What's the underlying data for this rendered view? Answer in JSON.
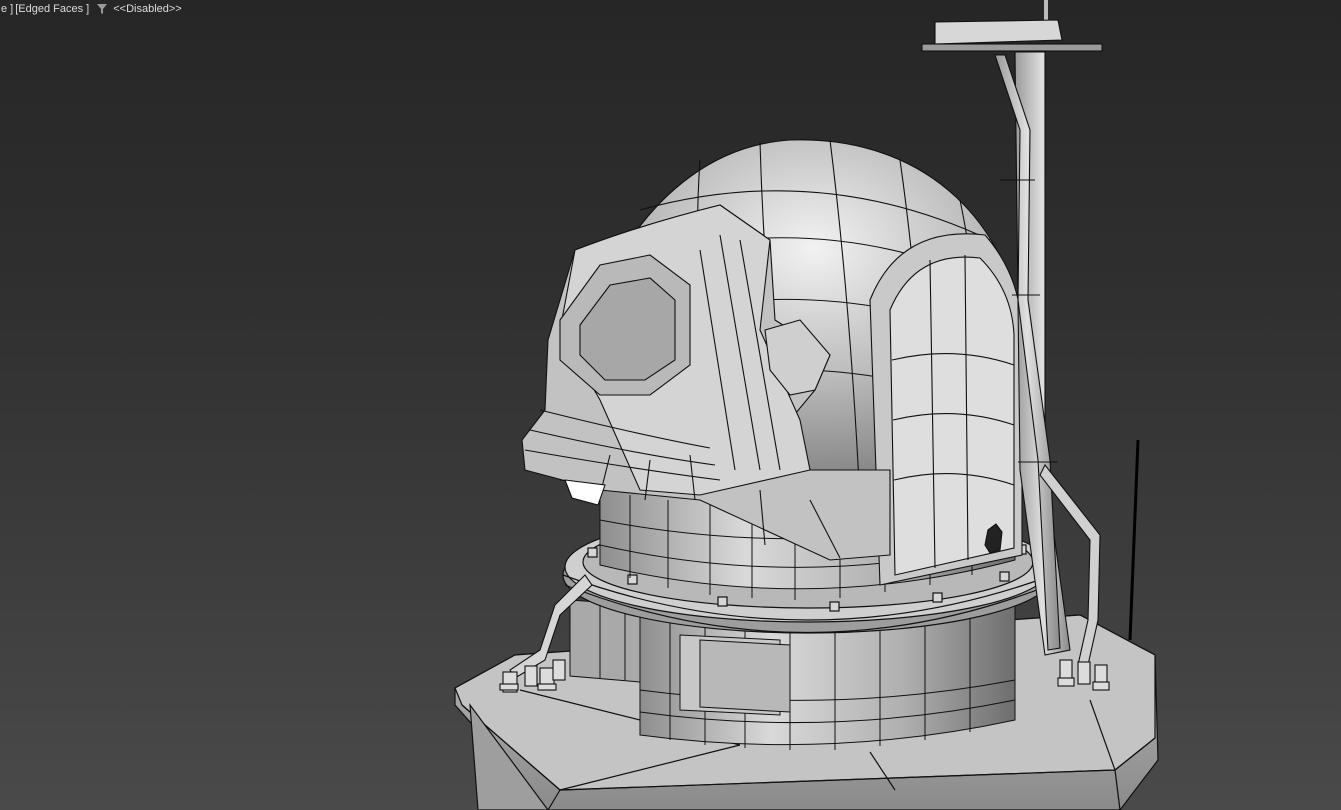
{
  "viewport": {
    "label_shading_tail": "e ]",
    "label_edged_faces": "[Edged Faces ]",
    "filter_icon": "funnel-icon",
    "label_disabled": "<<Disabled>>"
  },
  "scene": {
    "description_icon": "wireframe-dome-model",
    "colors": {
      "background_top": "#262626",
      "background_bottom": "#4a4a4a",
      "mesh_fill": "#b5b5b5",
      "mesh_highlight": "#e6e6e6",
      "edge": "#111111"
    }
  }
}
